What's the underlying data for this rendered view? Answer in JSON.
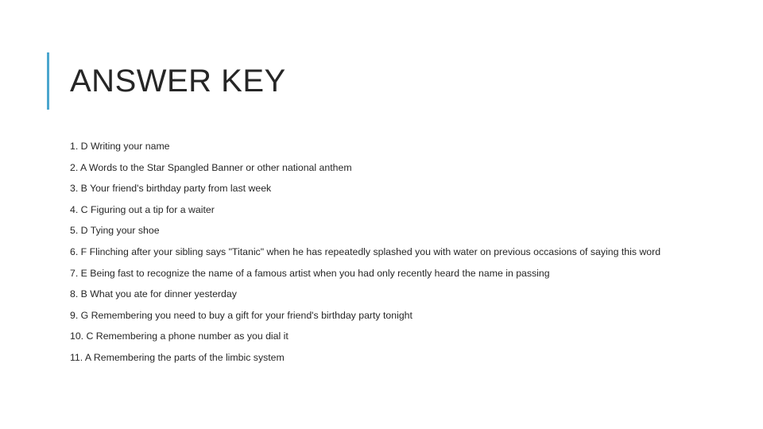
{
  "slide": {
    "title": "ANSWER KEY",
    "accent_color": "#4BA6CE",
    "text_color": "#262626",
    "background_color": "#FFFFFF"
  },
  "answers": [
    {
      "number": "1.",
      "choice": "D",
      "text": "1. D Writing your name"
    },
    {
      "number": "2.",
      "choice": "A",
      "text": "2. A Words to the Star Spangled Banner or other national anthem"
    },
    {
      "number": "3.",
      "choice": "B",
      "text": "3. B Your friend's birthday party from last week"
    },
    {
      "number": "4.",
      "choice": "C",
      "text": "4. C Figuring out a tip for a waiter"
    },
    {
      "number": "5.",
      "choice": "D",
      "text": "5. D Tying your shoe"
    },
    {
      "number": "6.",
      "choice": "F",
      "text": "6. F Flinching after your sibling says \"Titanic\" when he has repeatedly splashed you with water on previous occasions of saying this word"
    },
    {
      "number": "7.",
      "choice": "E",
      "text": "7. E Being fast to recognize the name of a famous artist when you had only recently heard the name in passing"
    },
    {
      "number": "8.",
      "choice": "B",
      "text": "8. B What you ate for dinner yesterday"
    },
    {
      "number": "9.",
      "choice": "G",
      "text": "9. G Remembering you need to buy a gift for your friend's birthday party tonight"
    },
    {
      "number": "10.",
      "choice": "C",
      "text": "10. C Remembering a phone number as you dial it"
    },
    {
      "number": "11.",
      "choice": "A",
      "text": "11. A Remembering the parts of the limbic system"
    }
  ]
}
